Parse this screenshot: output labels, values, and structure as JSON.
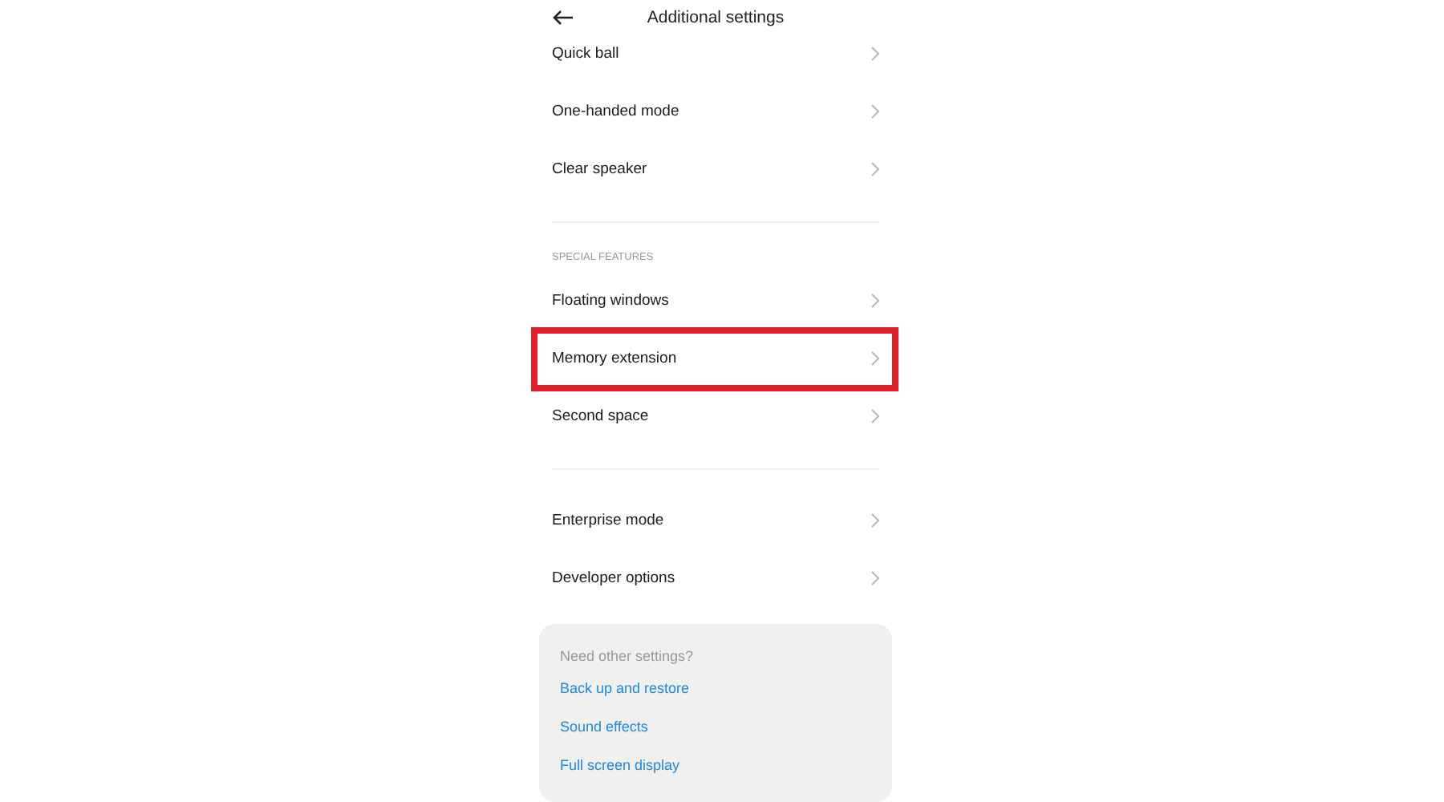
{
  "header": {
    "title": "Additional settings"
  },
  "sections": [
    {
      "items": [
        {
          "label": "Quick ball",
          "highlighted": false
        },
        {
          "label": "One-handed mode",
          "highlighted": false
        },
        {
          "label": "Clear speaker",
          "highlighted": false
        }
      ]
    },
    {
      "header": "SPECIAL FEATURES",
      "items": [
        {
          "label": "Floating windows",
          "highlighted": false
        },
        {
          "label": "Memory extension",
          "highlighted": true
        },
        {
          "label": "Second space",
          "highlighted": false
        }
      ]
    },
    {
      "items": [
        {
          "label": "Enterprise mode",
          "highlighted": false
        },
        {
          "label": "Developer options",
          "highlighted": false
        }
      ]
    }
  ],
  "other_settings": {
    "title": "Need other settings?",
    "links": [
      "Back up and restore",
      "Sound effects",
      "Full screen display"
    ]
  }
}
